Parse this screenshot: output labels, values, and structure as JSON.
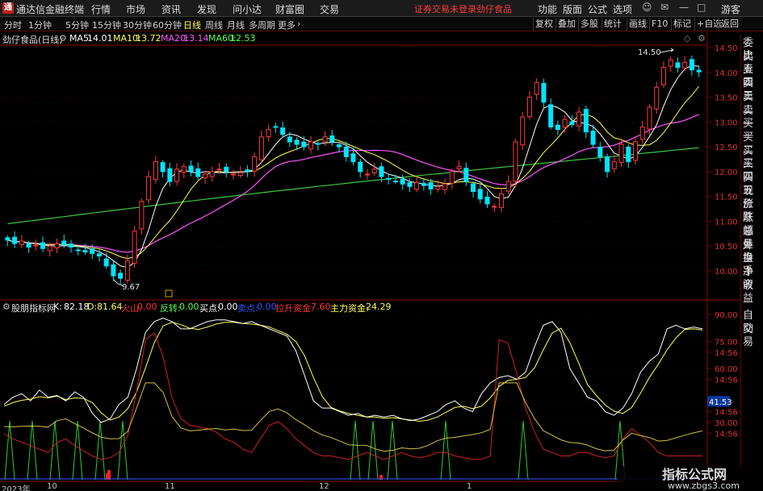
{
  "titlebar": {
    "app_name": "通达信金融终端",
    "menus": [
      "行情",
      "市场",
      "资讯",
      "发现",
      "问小达",
      "财富圈",
      "交易"
    ],
    "status": "证券交易未登录",
    "stock": "劲仔食品",
    "right_menus": [
      "功能",
      "版面",
      "公式",
      "选项"
    ],
    "guest": "游客"
  },
  "toolbar": {
    "timeframes": [
      "分时",
      "1分钟",
      "5分钟",
      "15分钟",
      "30分钟",
      "60分钟",
      "日线",
      "周线",
      "月线",
      "多周期",
      "更多"
    ],
    "active": "日线",
    "right": [
      "复权",
      "叠加",
      "多股",
      "统计",
      "画线",
      "F10",
      "标记",
      "+自选",
      "返回"
    ]
  },
  "main_chart": {
    "title": "劲仔食品(日线)",
    "ma": [
      {
        "label": "MA5:",
        "value": "14.01",
        "color": "#ffffff"
      },
      {
        "label": "MA10:",
        "value": "13.72",
        "color": "#ffff55"
      },
      {
        "label": "MA20:",
        "value": "13.14",
        "color": "#ff55ff"
      },
      {
        "label": "MA60:",
        "value": "12.53",
        "color": "#55ff55"
      }
    ],
    "y_ticks": [
      "14.50",
      "14.00",
      "13.50",
      "13.00",
      "12.50",
      "12.00",
      "11.50",
      "11.00",
      "10.50",
      "10.00"
    ],
    "high_mark": "14.50",
    "low_mark": "9.67"
  },
  "right_panel": [
    "委比",
    "卖五",
    "卖四",
    "卖三",
    "卖二",
    "卖一",
    "买一",
    "买二",
    "买三",
    "买四",
    "买五",
    "现价",
    "涨跌",
    "涨幅",
    "总量",
    "外盘",
    "换手",
    "净资",
    "收益"
  ],
  "right_panel_lower": [
    "自动",
    "交易"
  ],
  "indicator": {
    "name": "股朋指标网",
    "items": [
      {
        "label": "K:",
        "value": "82.18",
        "color": "#ffffff"
      },
      {
        "label": "D:",
        "value": "81.64",
        "color": "#ffff55"
      },
      {
        "label": "火山:",
        "value": "0.00",
        "color": "#ff3333"
      },
      {
        "label": "反转:",
        "value": "0.00",
        "color": "#55ff55"
      },
      {
        "label": "买点:",
        "value": "0.00",
        "color": "#ffffff"
      },
      {
        "label": "卖点:",
        "value": "0.00",
        "color": "#3355ff"
      },
      {
        "label": "拉升资金:",
        "value": "7.60",
        "color": "#ff3333"
      },
      {
        "label": "主力资金:",
        "value": "24.29",
        "color": "#ffff55"
      }
    ],
    "y_ticks": [
      "90.00",
      "75.00",
      "14:56",
      "60.00",
      "14:56",
      "41.53",
      "14:56",
      "30.00",
      "14:56"
    ]
  },
  "date_axis": [
    "2023年",
    "10",
    "11",
    "12",
    "1"
  ],
  "watermark": {
    "line1": "指标公式网",
    "line2": "www.zbgs3.com"
  },
  "colors": {
    "up": "#ff3b3b",
    "down": "#00e5ff",
    "ma5": "#ffffff",
    "ma10": "#ffff55",
    "ma20": "#ff55ff",
    "ma60": "#3ec63e",
    "border": "#8a0000"
  }
}
